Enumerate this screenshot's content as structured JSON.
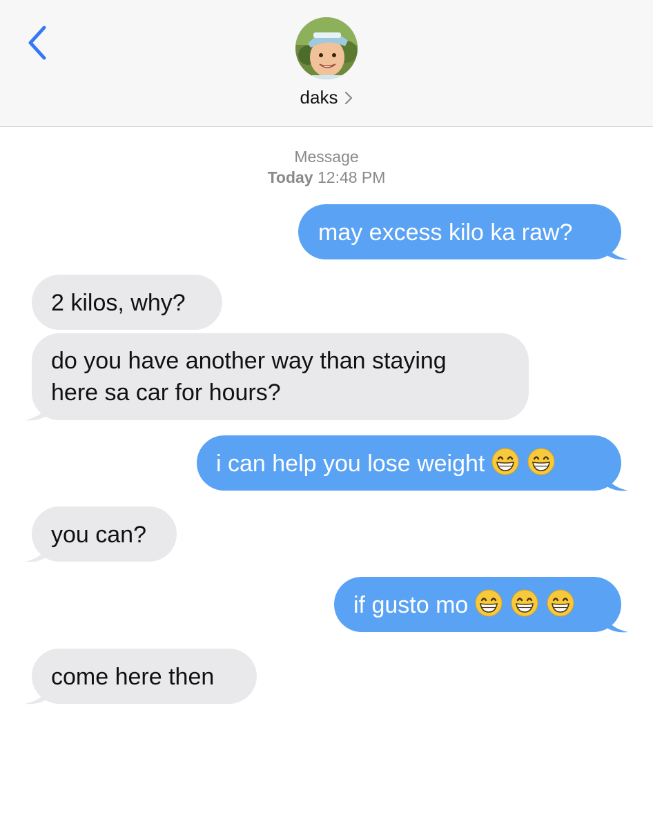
{
  "header": {
    "contact_name": "daks",
    "icons": {
      "back": "chevron-left-icon",
      "contact_disclosure": "chevron-right-icon"
    },
    "accent_color": "#3478f6"
  },
  "thread": {
    "service": "Message",
    "date_label": "Today",
    "time": "12:48 PM"
  },
  "messages": [
    {
      "direction": "outgoing",
      "text": "may excess kilo ka raw?",
      "emoji_count": 0
    },
    {
      "direction": "incoming",
      "text": "2 kilos, why?",
      "emoji_count": 0
    },
    {
      "direction": "incoming",
      "lines": [
        "do you have another way than staying",
        "here sa car for hours?"
      ],
      "emoji_count": 0
    },
    {
      "direction": "outgoing",
      "text": "i can help you lose weight ",
      "emoji_count": 2,
      "emoji": "grinning-face-icon"
    },
    {
      "direction": "incoming",
      "text": "you can?",
      "emoji_count": 0
    },
    {
      "direction": "outgoing",
      "text": "if gusto mo ",
      "emoji_count": 3,
      "emoji": "grinning-face-icon"
    },
    {
      "direction": "incoming",
      "text": "come here then",
      "emoji_count": 0
    }
  ],
  "colors": {
    "outgoing_bubble": "#5aa2f3",
    "incoming_bubble": "#e9e9eb",
    "meta_text": "#8a8a8e"
  }
}
